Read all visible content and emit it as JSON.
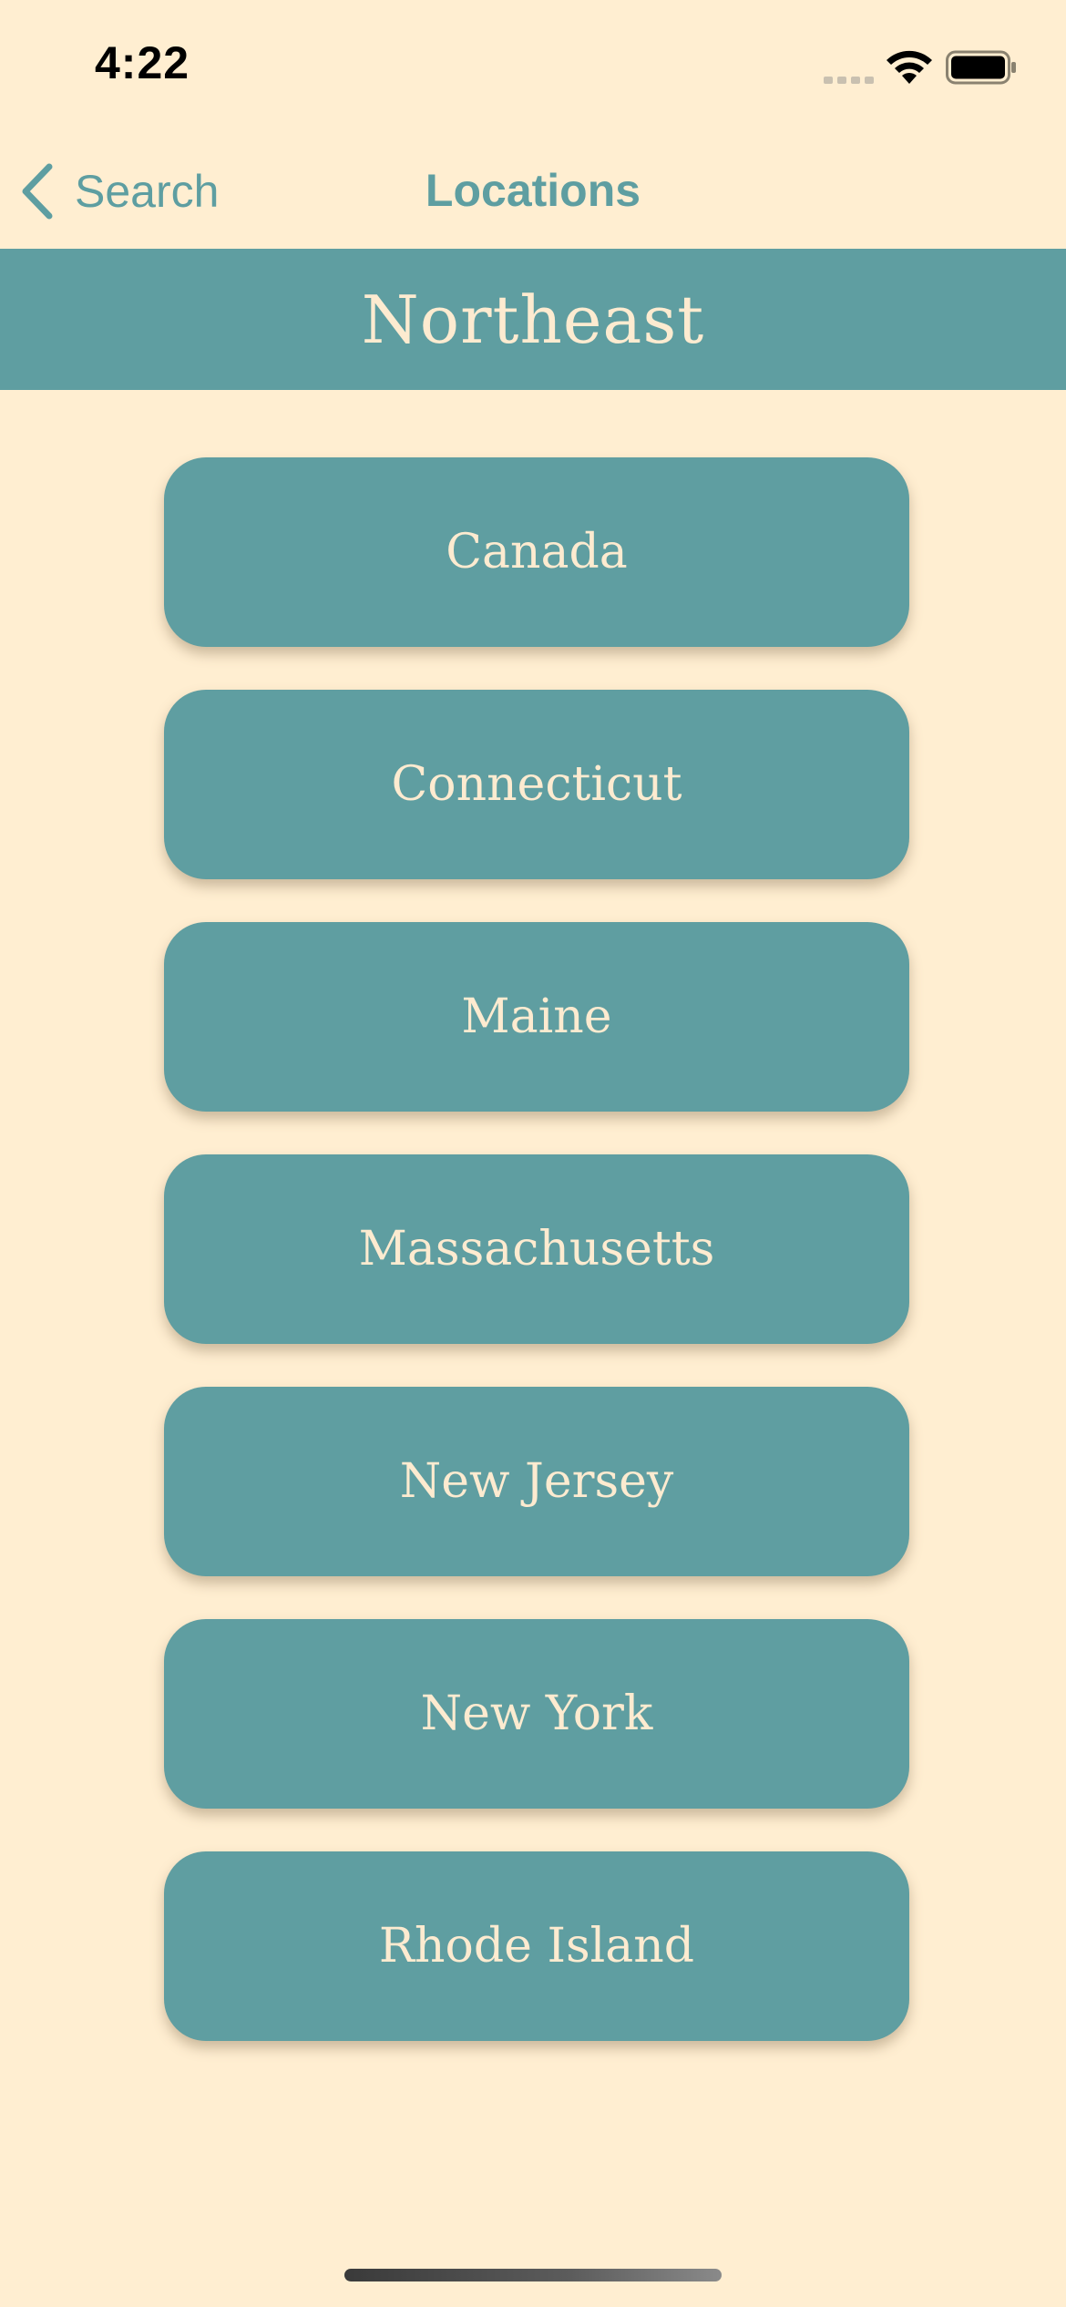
{
  "status_bar": {
    "time": "4:22",
    "icons": [
      "signal-icon",
      "wifi-icon",
      "battery-icon"
    ]
  },
  "nav": {
    "back_label": "Search",
    "back_icon": "chevron-left-icon",
    "title": "Locations"
  },
  "region": {
    "title": "Northeast"
  },
  "locations": [
    {
      "label": "Canada"
    },
    {
      "label": "Connecticut"
    },
    {
      "label": "Maine"
    },
    {
      "label": "Massachusetts"
    },
    {
      "label": "New Jersey"
    },
    {
      "label": "New York"
    },
    {
      "label": "Rhode Island"
    }
  ],
  "colors": {
    "background": "#ffeed1",
    "accent": "#5f9ea1",
    "button_text": "#fdebd0"
  }
}
